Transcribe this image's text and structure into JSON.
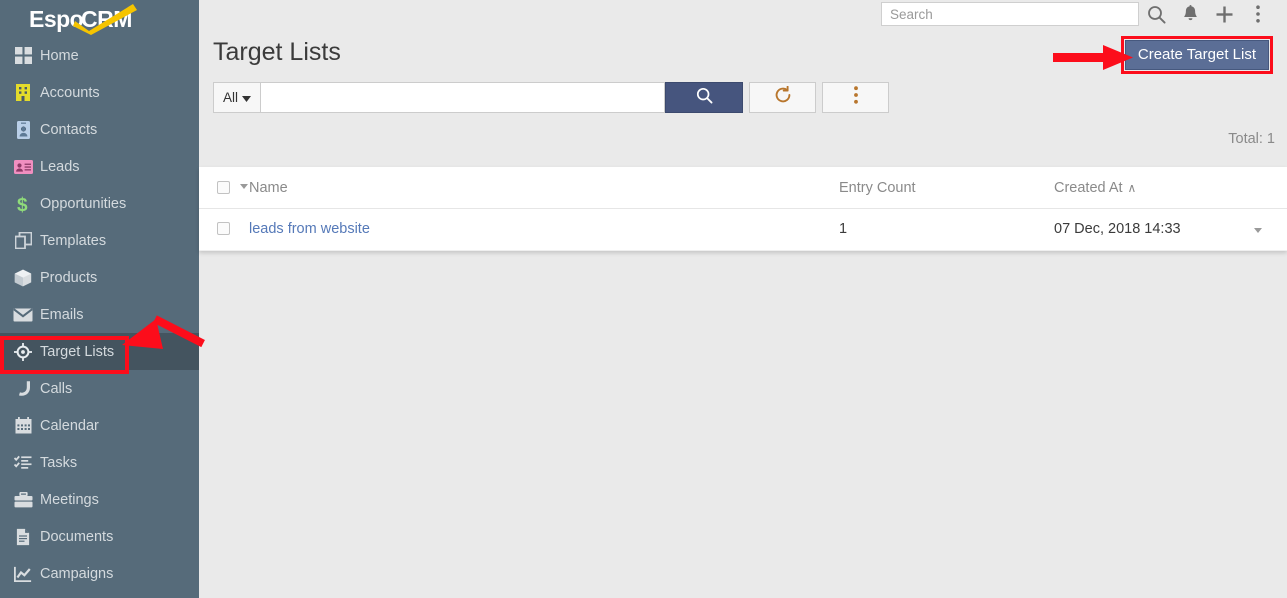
{
  "brand": {
    "logo_text_1": "Espo",
    "logo_text_2": "CRM",
    "sidebar_bg": "#566b7a",
    "active_bg": "#44545f",
    "accent_yellow": "#f5c400",
    "annotation_red": "#fc0d1b",
    "button_blue": "#5b6e96",
    "link_blue": "#5579b8"
  },
  "topbar": {
    "search_placeholder": "Search",
    "search_value": "",
    "icons": [
      {
        "name": "search-icon",
        "label": "Search"
      },
      {
        "name": "bell-icon",
        "label": "Notifications"
      },
      {
        "name": "plus-icon",
        "label": "Quick Create"
      },
      {
        "name": "kebab-menu-icon",
        "label": "Menu"
      }
    ]
  },
  "sidebar": {
    "items": [
      {
        "label": "Home",
        "icon": "grid-icon",
        "active": false
      },
      {
        "label": "Accounts",
        "icon": "building-icon",
        "active": false
      },
      {
        "label": "Contacts",
        "icon": "vcard-icon",
        "active": false
      },
      {
        "label": "Leads",
        "icon": "id-card-icon",
        "active": false
      },
      {
        "label": "Opportunities",
        "icon": "dollar-icon",
        "active": false
      },
      {
        "label": "Templates",
        "icon": "copy-icon",
        "active": false
      },
      {
        "label": "Products",
        "icon": "box-icon",
        "active": false
      },
      {
        "label": "Emails",
        "icon": "envelope-icon",
        "active": false
      },
      {
        "label": "Target Lists",
        "icon": "crosshair-icon",
        "active": true
      },
      {
        "label": "Calls",
        "icon": "phone-icon",
        "active": false
      },
      {
        "label": "Calendar",
        "icon": "calendar-icon",
        "active": false
      },
      {
        "label": "Tasks",
        "icon": "tasks-icon",
        "active": false
      },
      {
        "label": "Meetings",
        "icon": "briefcase-icon",
        "active": false
      },
      {
        "label": "Documents",
        "icon": "document-icon",
        "active": false
      },
      {
        "label": "Campaigns",
        "icon": "chart-line-icon",
        "active": false
      }
    ]
  },
  "page": {
    "title": "Target Lists",
    "create_button": "Create Target List",
    "total_label": "Total: 1"
  },
  "search_row": {
    "filter_label": "All",
    "text_value": "",
    "text_placeholder": "",
    "search_button_icon": "search-icon",
    "refresh_button_icon": "refresh-icon",
    "more_button_icon": "kebab-menu-icon"
  },
  "table": {
    "columns": [
      {
        "key": "check",
        "label": ""
      },
      {
        "key": "name",
        "label": "Name",
        "sorted": false
      },
      {
        "key": "entryCount",
        "label": "Entry Count",
        "sorted": false
      },
      {
        "key": "createdAt",
        "label": "Created At",
        "sorted": true,
        "sort_dir": "asc",
        "sort_glyph": "∧"
      },
      {
        "key": "menu",
        "label": ""
      }
    ],
    "rows": [
      {
        "name": "leads from website",
        "entryCount": "1",
        "createdAt": "07 Dec, 2018 14:33"
      }
    ]
  },
  "annotations": [
    {
      "name": "arrow-to-create-button",
      "type": "arrow-right"
    },
    {
      "name": "arrow-to-target-lists",
      "type": "arrow-down-left"
    },
    {
      "name": "highlight-box-create-button",
      "type": "rect"
    },
    {
      "name": "highlight-box-target-lists",
      "type": "rect"
    }
  ]
}
